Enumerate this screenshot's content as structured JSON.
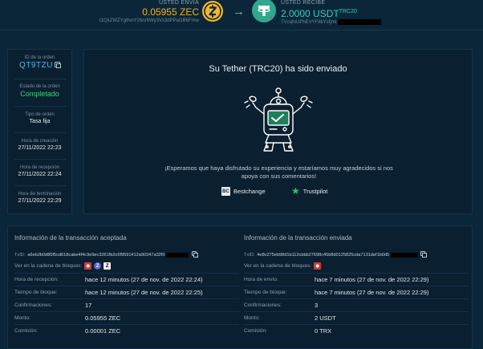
{
  "exchange": {
    "send": {
      "label": "USTED ENVÍA",
      "amount": "0.05955 ZEC",
      "address": "t1QkZWZYg8vnY26nr6Wy3Vx3dPPaGB6Fmw"
    },
    "receive": {
      "label": "USTED RECIBE",
      "amount": "2.0000 USDT",
      "network_sup": "TRC20",
      "address": "TVcqfoUPhEVYF8kYxfjmt"
    },
    "colors": {
      "send_amount": "#f2b01e",
      "receive_amount": "#34d0c0",
      "zec_coin": "#f4b728",
      "usdt_coin": "#2fa88d"
    },
    "icons": {
      "send_coin": "zcash-coin-icon",
      "arrow": "arrow-right-icon",
      "receive_coin": "tether-coin-icon"
    }
  },
  "order": {
    "id_label": "ID de la orden",
    "id_value": "QT9TZU",
    "status_label": "Estado de la orden",
    "status_value": "Completado",
    "type_label": "Tipo de orden",
    "type_value": "Tasa fija",
    "created_label": "Hora de creación",
    "created_value": "27/11/2022 22:23",
    "received_label": "Hora de recepción",
    "received_value": "27/11/2022 22:24",
    "finished_label": "Hora de terminación",
    "finished_value": "27/11/2022 22:29",
    "status_color": "#3fd57a"
  },
  "success": {
    "title": "Su Tether (TRC20) ha sido enviado",
    "message": "¡Esperamos que haya disfrutado su experiencia y estaríamos muy agradecidos si nos apoya con sus comentarios!",
    "review_bestchange": "Bestchange",
    "review_trustpilot": "Trustpilot",
    "bestchange_logo_text": "BC",
    "trustpilot_icon": "star-icon",
    "illustration": "robot-illustration"
  },
  "tx_accepted": {
    "heading": "Información de la transacción aceptada",
    "txid_label": "TxID:",
    "txid_value": "a6eb2b0d85f5cd618cabe4f4c9e9ec3261fb2c6f9591412a90347a32f0",
    "chain_label": "Ver en la cadena de bloques:",
    "chain_icons": [
      "blockchair-icon",
      "zcash-explorer-icon",
      "zcash-z-icon"
    ],
    "rows": [
      {
        "label": "Hora de recepción:",
        "value": "hace 12 minutos (27 de nov. de 2022 22:24)"
      },
      {
        "label": "Tiempo de bloque:",
        "value": "hace 12 minutos (27 de nov. de 2022 22:25)"
      },
      {
        "label": "Confirmaciones:",
        "value": "17"
      },
      {
        "label": "Monto:",
        "value": "0.05955 ZEC"
      },
      {
        "label": "Comisión:",
        "value": "0.00001 ZEC"
      }
    ]
  },
  "tx_sent": {
    "heading": "Información de la transacción enviada",
    "txid_label": "TxID:",
    "txid_value": "4e8c275eb98d1b112cbbb27698c45b8d0125825cda7131def1b0d5",
    "chain_label": "Ver en la cadena de bloques:",
    "chain_icons": [
      "tronscan-icon"
    ],
    "rows": [
      {
        "label": "Hora de envío:",
        "value": "hace 7 minutos (27 de nov. de 2022 22:29)"
      },
      {
        "label": "Tiempo de bloque:",
        "value": "hace 7 minutos (27 de nov. de 2022 22:29)"
      },
      {
        "label": "Confirmaciones:",
        "value": "3"
      },
      {
        "label": "Monto:",
        "value": "2 USDT"
      },
      {
        "label": "Comisión:",
        "value": "0 TRX"
      }
    ]
  }
}
